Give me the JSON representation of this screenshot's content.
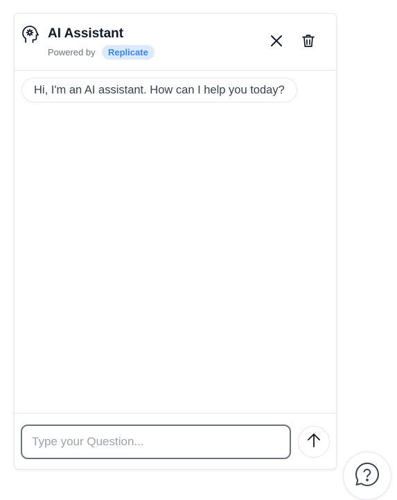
{
  "header": {
    "title": "AI Assistant",
    "powered_by": "Powered by",
    "provider_badge": "Replicate",
    "icons": {
      "logo": "brain-head-icon",
      "close": "close-icon",
      "delete": "trash-icon"
    }
  },
  "messages": [
    {
      "role": "assistant",
      "text": "Hi, I'm an AI assistant. How can I help you today?"
    }
  ],
  "composer": {
    "value": "",
    "placeholder": "Type your Question...",
    "send_icon": "arrow-up-icon"
  },
  "help_button": {
    "icon": "question-chat-icon"
  },
  "colors": {
    "badge_bg": "#dbeafe",
    "badge_text": "#3b82f6",
    "border": "#e5e7eb",
    "input_border": "#6b7280"
  }
}
